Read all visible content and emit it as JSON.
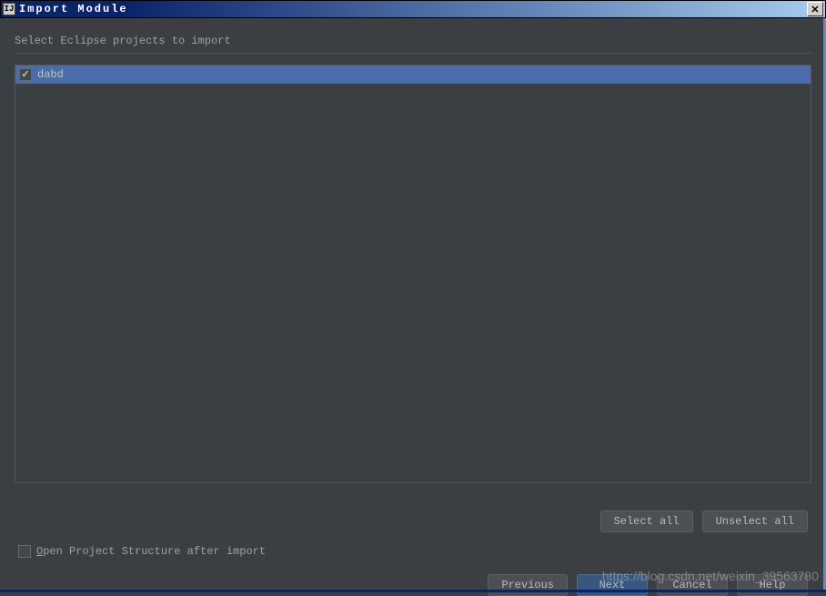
{
  "window": {
    "title": "Import Module"
  },
  "main": {
    "instruction": "Select Eclipse projects to import",
    "projects": [
      {
        "name": "dabd",
        "checked": true
      }
    ],
    "buttons": {
      "select_all": "Select all",
      "unselect_all": "Unselect all"
    },
    "option": {
      "label_prefix": "O",
      "label_rest": "pen Project Structure after import",
      "checked": false
    }
  },
  "footer": {
    "previous": "Previous",
    "next": "Next",
    "cancel": "Cancel",
    "help": "Help"
  },
  "watermark": "https://blog.csdn.net/weixin_39563780"
}
